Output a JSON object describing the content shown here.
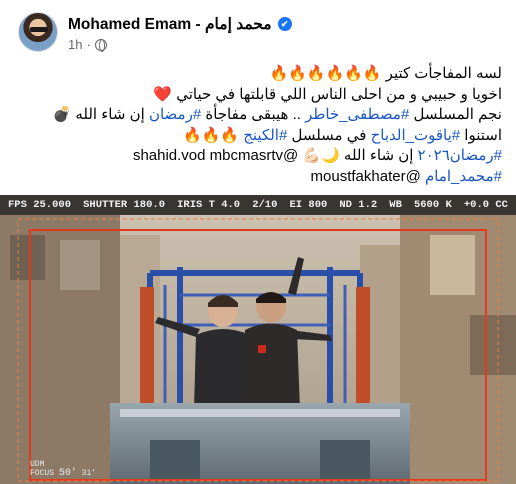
{
  "post": {
    "author": "Mohamed Emam - محمد إمام",
    "time": "1h",
    "dot": "·",
    "verified_mark": "✔",
    "lines": [
      [
        {
          "t": "لسه المفاجأت كتير "
        },
        {
          "t": "🔥🔥🔥🔥🔥🔥",
          "c": "fire"
        }
      ],
      [
        {
          "t": "اخويا و حبيبي و من احلى الناس اللي قابلتها في حياتي "
        },
        {
          "t": "❤️",
          "c": "heart"
        }
      ],
      [
        {
          "t": "نجم المسلسل "
        },
        {
          "t": "#مصطفى_خاطر",
          "c": "hashtag"
        },
        {
          "t": " .. هيبقى مفاجأة "
        },
        {
          "t": "#رمضان",
          "c": "hashtag"
        },
        {
          "t": " إن شاء الله "
        },
        {
          "t": "💣",
          "c": "bomb"
        }
      ],
      [
        {
          "t": "استنوا "
        },
        {
          "t": "#ياقوت_الدباح",
          "c": "hashtag"
        },
        {
          "t": " في مسلسل "
        },
        {
          "t": "#الكينج",
          "c": "hashtag"
        },
        {
          "t": " "
        },
        {
          "t": "🔥🔥🔥",
          "c": "fire"
        }
      ],
      [
        {
          "t": "#رمضان٢٠٢٦",
          "c": "hashtag"
        },
        {
          "t": " إن شاء الله 🌙💪🏻 @shahid.vod mbcmasrtv"
        }
      ],
      [
        {
          "t": "#محمد_امام",
          "c": "hashtag"
        },
        {
          "t": " @moustfakhater"
        }
      ]
    ]
  },
  "photo": {
    "hud": [
      "FPS 25.000",
      "SHUTTER 180.0",
      "IRIS T 4.0",
      "2/10",
      "EI 800",
      "ND 1.2",
      "WB",
      "5600 K",
      "+0.0 CC"
    ],
    "bottom_label_1": "UDM",
    "bottom_label_2": "FOCUS",
    "focus_value": "50'",
    "focus_small": "31'"
  },
  "colors": {
    "hashtag": "#1a57c2",
    "verified": "#1877f2",
    "frame_guide": "#e23a1a"
  }
}
